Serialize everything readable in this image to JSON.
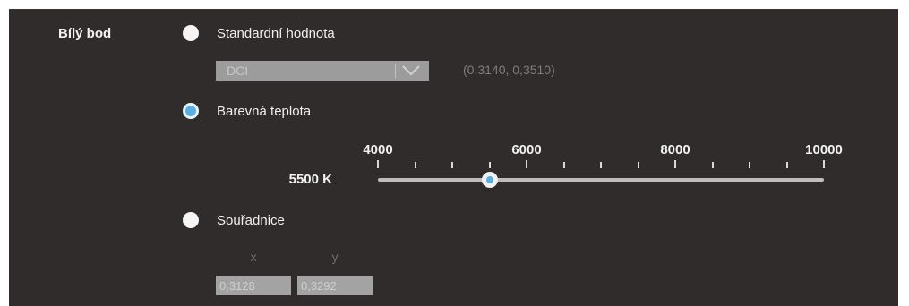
{
  "white_point": {
    "label": "Bílý bod",
    "options": {
      "standard": {
        "label": "Standardní hodnota",
        "selected": false,
        "dropdown_value": "DCI",
        "coordinates": "(0,3140, 0,3510)"
      },
      "color_temperature": {
        "label": "Barevná teplota",
        "selected": true,
        "slider": {
          "min": 4000,
          "max": 10000,
          "value": 5500,
          "value_label": "5500 K",
          "major_tick_labels": [
            "4000",
            "6000",
            "8000",
            "10000"
          ],
          "minor_tick_step": 500
        }
      },
      "coordinates": {
        "label": "Souřadnice",
        "selected": false,
        "x_label": "x",
        "y_label": "y",
        "x_value": "0,3128",
        "y_value": "0,3292"
      }
    }
  },
  "colors": {
    "panel_bg": "#2f2c2b",
    "accent": "#5aaee0",
    "disabled_field": "#9c9c9c"
  },
  "icons": {
    "dropdown": "chevron-down-icon"
  }
}
